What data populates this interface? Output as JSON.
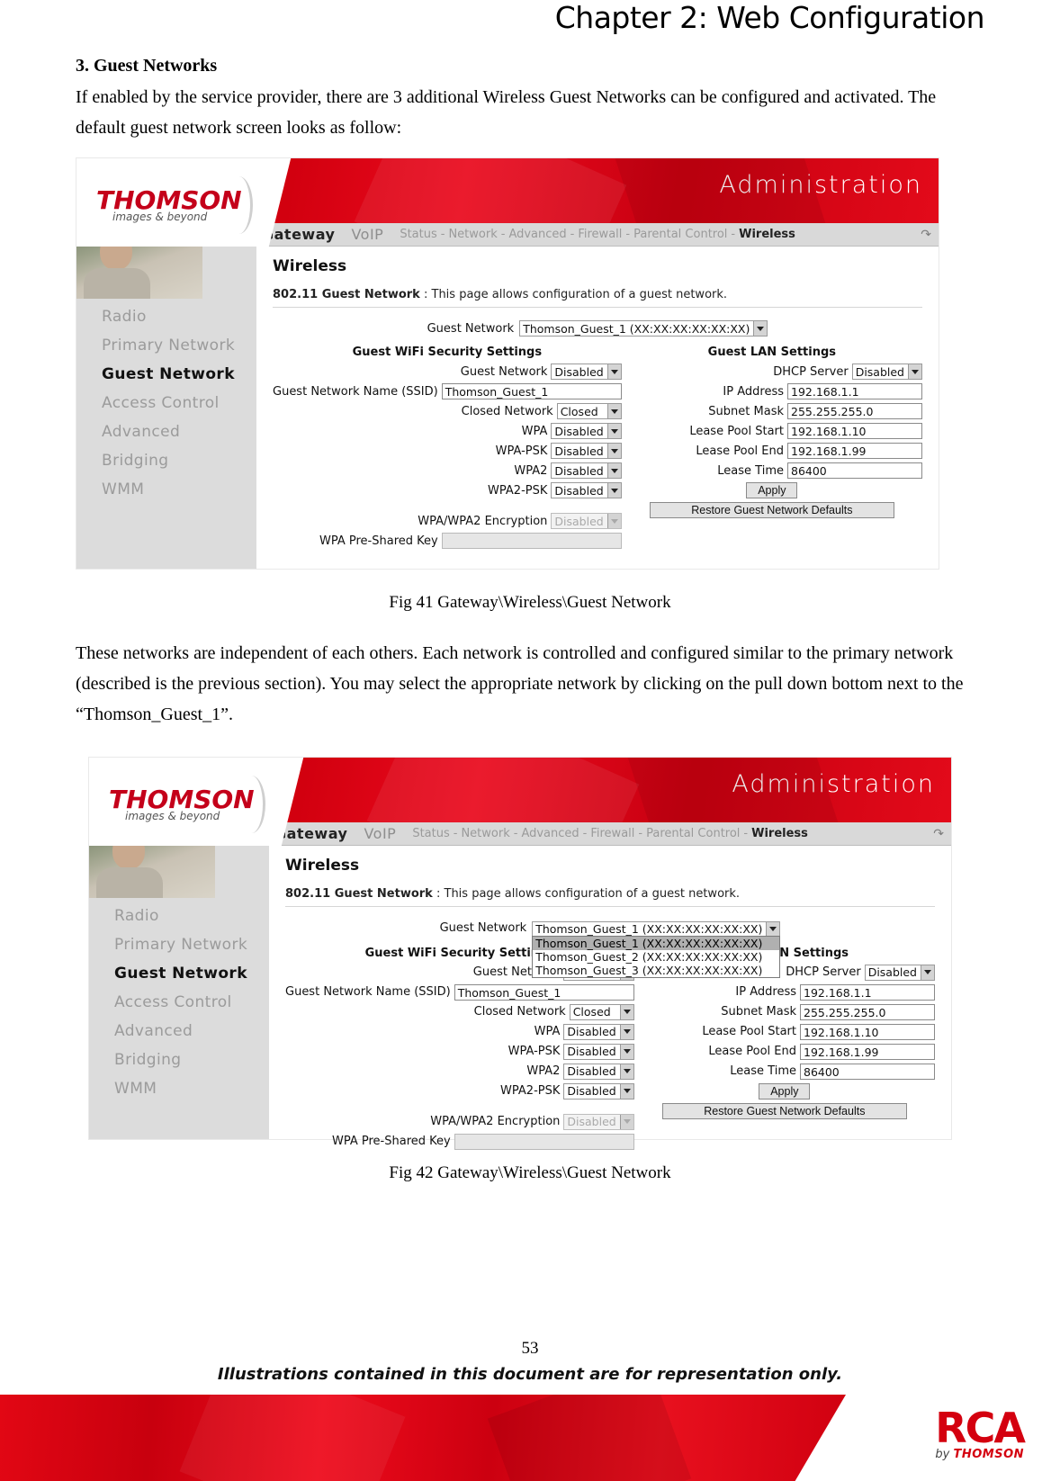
{
  "page": {
    "chapter_title": "Chapter 2: Web Configuration",
    "section_heading": "3. Guest Networks",
    "paragraph_1": "If enabled by the service provider, there are 3 additional Wireless Guest Networks can be configured and activated.    The default guest network screen looks as follow:",
    "paragraph_2": "These networks are independent of each others.    Each network is controlled and configured similar to the primary network (described is the previous section).    You may select the appropriate network by clicking on the pull down bottom next to the “Thomson_Guest_1”.",
    "fig41_caption": "Fig 41 Gateway\\Wireless\\Guest Network",
    "fig42_caption": "Fig 42 Gateway\\Wireless\\Guest Network",
    "page_number": "53",
    "footer_note": "Illustrations contained in this document are for representation only.",
    "footer_logo_word": "RCA",
    "footer_logo_by": "by",
    "footer_logo_brand": "THOMSON"
  },
  "router_ui": {
    "brand": "THOMSON",
    "brand_tagline": "images & beyond",
    "banner_title": "Administration",
    "nav": {
      "primary": [
        "Gateway",
        "VoIP"
      ],
      "sub": [
        "Status",
        "Network",
        "Advanced",
        "Firewall",
        "Parental Control",
        "Wireless"
      ],
      "active_sub": "Wireless",
      "separator": "-",
      "refresh_icon": "refresh-icon"
    },
    "sidebar": {
      "items": [
        "Radio",
        "Primary Network",
        "Guest Network",
        "Access Control",
        "Advanced",
        "Bridging",
        "WMM"
      ],
      "active": "Guest Network"
    },
    "content": {
      "title": "Wireless",
      "subtitle_bold": "802.11 Guest Network",
      "subtitle_sep": ":",
      "subtitle_text": "This page allows configuration of a guest network."
    },
    "guest_network_selector": {
      "label": "Guest Network",
      "value": "Thomson_Guest_1 (XX:XX:XX:XX:XX:XX)",
      "options": [
        "Thomson_Guest_1 (XX:XX:XX:XX:XX:XX)",
        "Thomson_Guest_2 (XX:XX:XX:XX:XX:XX)",
        "Thomson_Guest_3 (XX:XX:XX:XX:XX:XX)"
      ],
      "selected_index": 0
    },
    "wifi_security": {
      "title": "Guest WiFi Security Settings",
      "fields": [
        {
          "label": "Guest Network",
          "type": "select",
          "value": "Disabled",
          "disabled": false
        },
        {
          "label": "Guest Network Name (SSID)",
          "type": "text",
          "value": "Thomson_Guest_1",
          "disabled": false
        },
        {
          "label": "Closed Network",
          "type": "select",
          "value": "Closed",
          "disabled": false
        },
        {
          "label": "WPA",
          "type": "select",
          "value": "Disabled",
          "disabled": false
        },
        {
          "label": "WPA-PSK",
          "type": "select",
          "value": "Disabled",
          "disabled": false
        },
        {
          "label": "WPA2",
          "type": "select",
          "value": "Disabled",
          "disabled": false
        },
        {
          "label": "WPA2-PSK",
          "type": "select",
          "value": "Disabled",
          "disabled": false
        }
      ],
      "encryption": {
        "label": "WPA/WPA2 Encryption",
        "value": "Disabled",
        "disabled": true
      },
      "preshared_key": {
        "label": "WPA Pre-Shared Key",
        "value": "",
        "disabled": true
      }
    },
    "lan_settings": {
      "title": "Guest LAN Settings",
      "fields": [
        {
          "label": "DHCP Server",
          "type": "select",
          "value": "Disabled"
        },
        {
          "label": "IP Address",
          "type": "text",
          "value": "192.168.1.1"
        },
        {
          "label": "Subnet Mask",
          "type": "text",
          "value": "255.255.255.0"
        },
        {
          "label": "Lease Pool Start",
          "type": "text",
          "value": "192.168.1.10"
        },
        {
          "label": "Lease Pool End",
          "type": "text",
          "value": "192.168.1.99"
        },
        {
          "label": "Lease Time",
          "type": "text",
          "value": "86400"
        }
      ],
      "apply_label": "Apply",
      "restore_label": "Restore Guest Network Defaults"
    },
    "colors": {
      "brand_red": "#c4001a",
      "banner_red": "#d2000f",
      "sidebar_gray": "#dcdcdc",
      "navbar_gray": "#d9d9d9"
    }
  }
}
